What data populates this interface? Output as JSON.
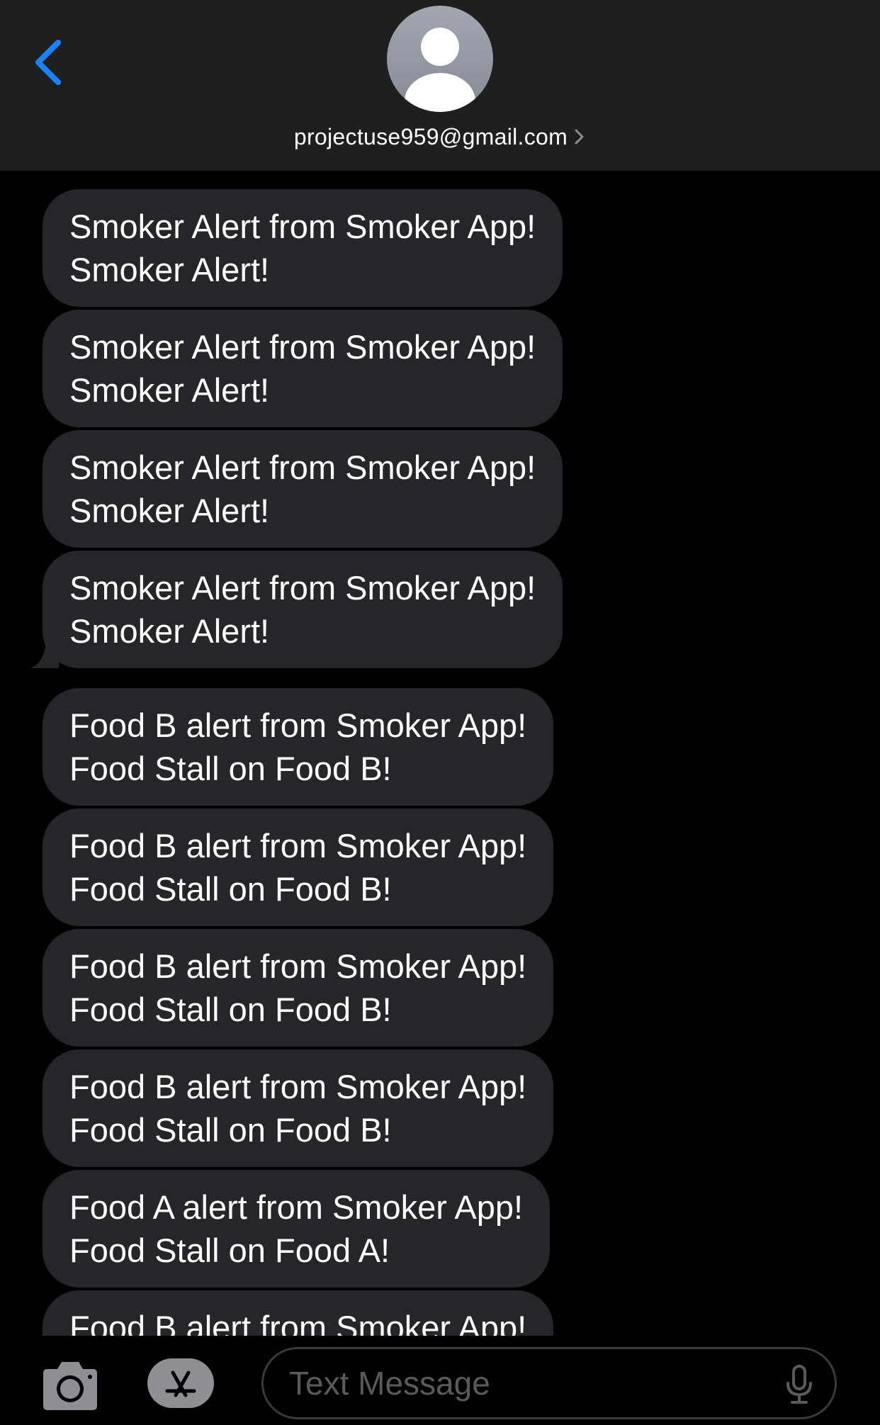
{
  "header": {
    "contact": "projectuse959@gmail.com",
    "back_icon": "chevron-left-icon",
    "avatar_icon": "person-silhouette-icon",
    "details_icon": "chevron-right-icon"
  },
  "messages": [
    {
      "text": "Smoker Alert from Smoker App!\nSmoker Alert!",
      "tail": false
    },
    {
      "text": "Smoker Alert from Smoker App!\nSmoker Alert!",
      "tail": false
    },
    {
      "text": "Smoker Alert from Smoker App!\nSmoker Alert!",
      "tail": false
    },
    {
      "text": "Smoker Alert from Smoker App!\nSmoker Alert!",
      "tail": true
    },
    {
      "text": "Food B alert from Smoker App!\nFood Stall on Food B!",
      "tail": false
    },
    {
      "text": "Food B alert from Smoker App!\nFood Stall on Food B!",
      "tail": false
    },
    {
      "text": "Food B alert from Smoker App!\nFood Stall on Food B!",
      "tail": false
    },
    {
      "text": "Food B alert from Smoker App!\nFood Stall on Food B!",
      "tail": false
    },
    {
      "text": "Food A alert from Smoker App!\nFood Stall on Food A!",
      "tail": false
    },
    {
      "text": "Food B alert from Smoker App!\nFood Stall on Food B!",
      "tail": false
    }
  ],
  "input_bar": {
    "placeholder": "Text Message",
    "camera_icon": "camera-icon",
    "apps_icon": "app-store-icon",
    "mic_icon": "microphone-icon"
  },
  "colors": {
    "header_bg": "#1f1f1f",
    "bubble_bg": "#26252a",
    "accent": "#1a82fb",
    "text": "#ffffff",
    "placeholder": "#5a5a5e"
  }
}
